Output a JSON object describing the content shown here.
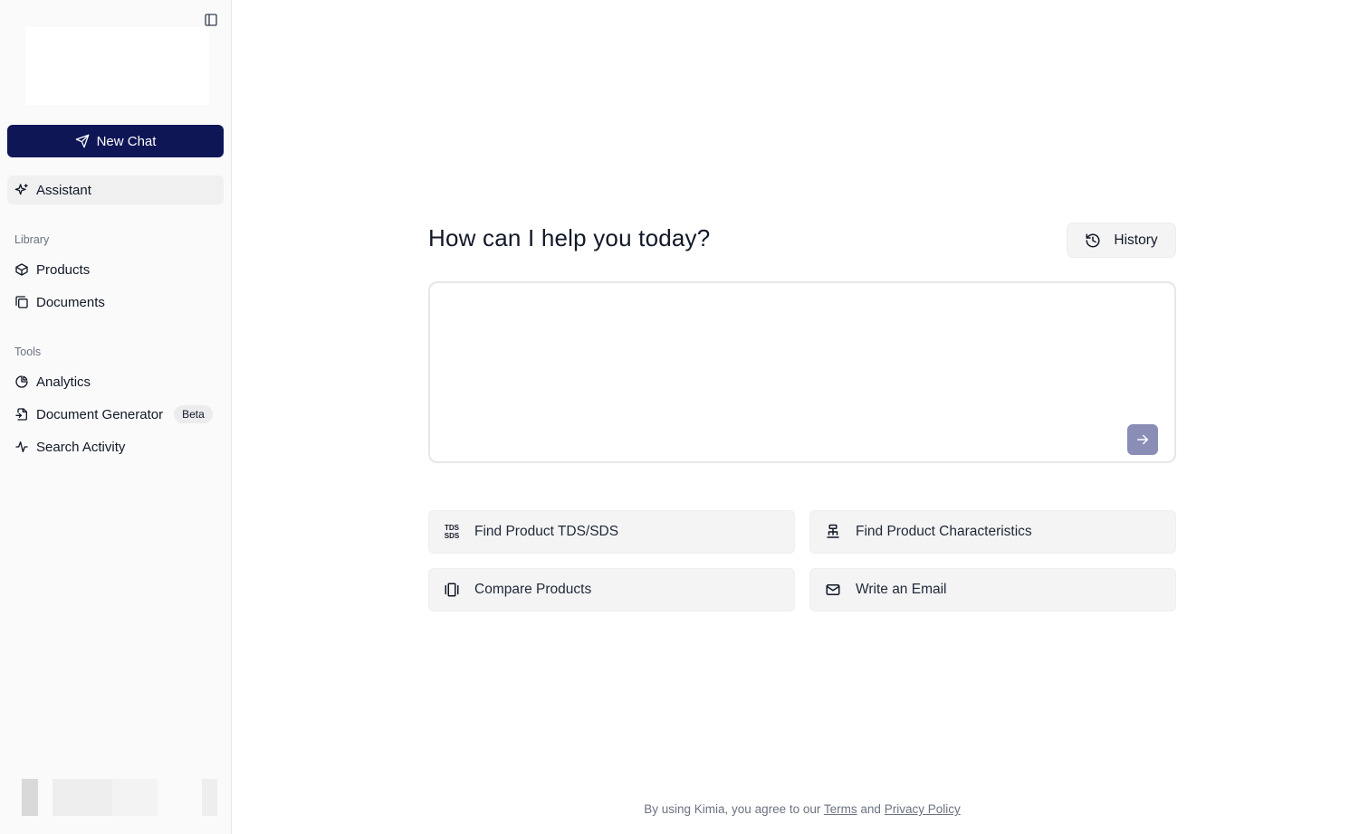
{
  "sidebar": {
    "new_chat_label": "New Chat",
    "assistant_label": "Assistant",
    "library_label": "Library",
    "library_items": [
      {
        "label": "Products",
        "icon": "box-icon"
      },
      {
        "label": "Documents",
        "icon": "documents-icon"
      }
    ],
    "tools_label": "Tools",
    "tools_items": [
      {
        "label": "Analytics",
        "icon": "pie-chart-icon"
      },
      {
        "label": "Document Generator",
        "icon": "file-generate-icon",
        "badge": "Beta"
      },
      {
        "label": "Search Activity",
        "icon": "activity-icon"
      }
    ]
  },
  "main": {
    "greeting": "How can I help you today?",
    "history_label": "History",
    "prompt_value": "",
    "suggestions": [
      {
        "label": "Find Product TDS/SDS",
        "icon": "tds-sds-icon",
        "icon_text_top": "TDS",
        "icon_text_bottom": "SDS"
      },
      {
        "label": "Find Product Characteristics",
        "icon": "characteristics-icon"
      },
      {
        "label": "Compare Products",
        "icon": "compare-icon"
      },
      {
        "label": "Write an Email",
        "icon": "mail-icon"
      }
    ]
  },
  "footer": {
    "prefix": "By using Kimia, you agree to our",
    "terms_label": "Terms",
    "and": "and",
    "privacy_label": "Privacy Policy"
  },
  "colors": {
    "accent": "#0f1656",
    "send_button": "#8a8db5",
    "sidebar_bg": "#fafafa"
  }
}
